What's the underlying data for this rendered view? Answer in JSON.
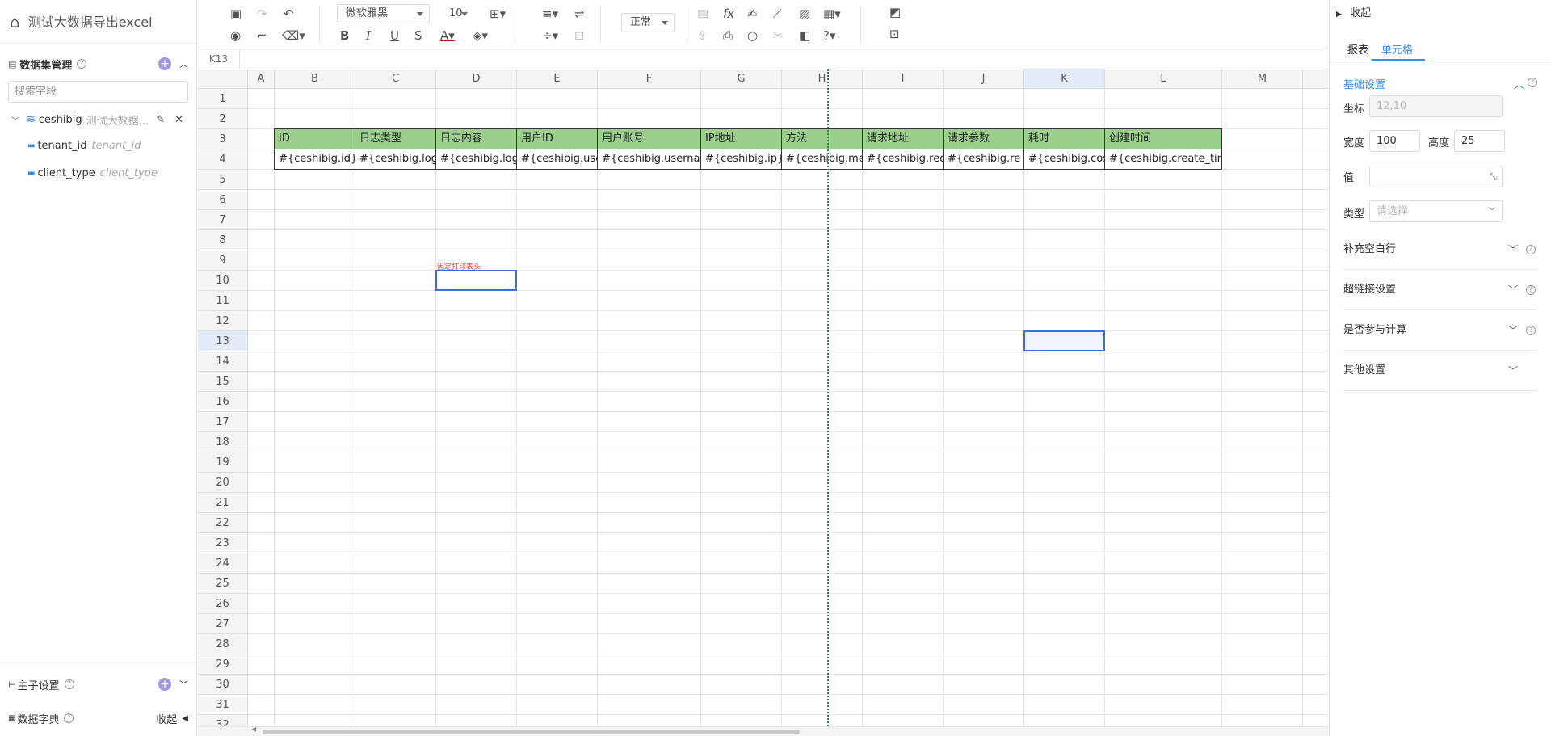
{
  "app": {
    "title": "测试大数据导出excel"
  },
  "left": {
    "dataset_label": "数据集管理",
    "search_placeholder": "搜索字段",
    "dataset": {
      "name": "ceshibig",
      "desc": "测试大数据..."
    },
    "fields": [
      {
        "name": "tenant_id",
        "desc": "tenant_id"
      },
      {
        "name": "client_type",
        "desc": "client_type"
      }
    ],
    "main_sub_label": "主子设置",
    "dict_label": "数据字典",
    "collapse_label": "收起"
  },
  "toolbar": {
    "font_family": "微软雅黑",
    "font_size": "10",
    "text_mode": "正常"
  },
  "formula": {
    "cell_ref": "K13"
  },
  "grid": {
    "columns": [
      "A",
      "B",
      "C",
      "D",
      "E",
      "F",
      "G",
      "H",
      "I",
      "J",
      "K",
      "L",
      "M"
    ],
    "rows": [
      "1",
      "2",
      "3",
      "4",
      "5",
      "6",
      "7",
      "8",
      "9",
      "10",
      "11",
      "12",
      "13",
      "14",
      "15",
      "16",
      "17",
      "18",
      "19",
      "20",
      "21",
      "22",
      "23",
      "24",
      "25",
      "26",
      "27",
      "28",
      "29",
      "30",
      "31",
      "32"
    ],
    "header_row": [
      "ID",
      "日志类型",
      "日志内容",
      "用户ID",
      "用户账号",
      "IP地址",
      "方法",
      "请求地址",
      "请求参数",
      "耗时",
      "创建时间"
    ],
    "data_row": [
      "#{ceshibig.id}",
      "#{ceshibig.log",
      "#{ceshibig.log",
      "#{ceshibig.use",
      "#{ceshibig.userna",
      "#{ceshibig.ip}",
      "#{ceshibig.me",
      "#{ceshibig.req",
      "#{ceshibig.re",
      "#{ceshibig.cos",
      "#{ceshibig.create_tim"
    ],
    "fixed_print_label": "固定打印表头"
  },
  "right": {
    "collapse_label": "收起",
    "tabs": [
      "报表",
      "单元格"
    ],
    "basic_settings": "基础设置",
    "coord_label": "坐标",
    "coord_value": "12,10",
    "width_label": "宽度",
    "width_value": "100",
    "height_label": "高度",
    "height_value": "25",
    "value_label": "值",
    "type_label": "类型",
    "type_placeholder": "请选择",
    "sections": [
      "补充空白行",
      "超链接设置",
      "是否参与计算",
      "其他设置"
    ]
  }
}
